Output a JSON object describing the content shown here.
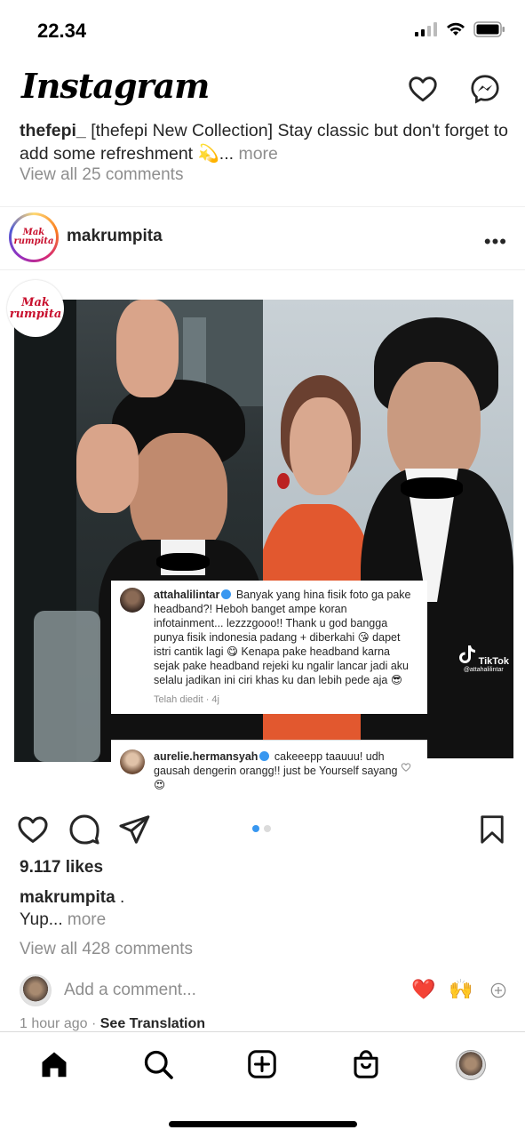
{
  "status_bar": {
    "time": "22.34"
  },
  "header": {
    "logo": "Instagram"
  },
  "previous_post": {
    "caption_user": "thefepi_",
    "caption_text": "[thefepi New Collection] Stay classic but don't forget to add some refreshment 💫...",
    "more_label": "more",
    "view_comments": "View all 25 comments"
  },
  "post": {
    "username": "makrumpita",
    "avatar_text_line1": "Mak",
    "avatar_text_line2": "rumpita",
    "image": {
      "watermark_line1": "Mak",
      "watermark_line2": "rumpita",
      "tiktok_label": "TikTok",
      "tiktok_handle": "@attahalilintar",
      "comment1": {
        "user": "attahalilintar",
        "text": "Banyak yang hina fisik foto ga pake headband?! Heboh banget ampe koran infotainment... lezzzgooo!! Thank u god bangga punya fisik indonesia padang + diberkahi 😘 dapet istri cantik lagi 😋 Kenapa pake headband karna sejak pake headband rejeki ku ngalir lancar jadi aku selalu jadikan ini ciri khas ku dan lebih pede aja 😎",
        "meta": "Telah diedit · 4j"
      },
      "comment2": {
        "user": "aurelie.hermansyah",
        "text": "cakeeepp taauuu! udh gausah dengerin orangg!! just be Yourself sayang 😍"
      }
    },
    "likes": "9.117 likes",
    "caption_user": "makrumpita",
    "caption_user_suffix": ".",
    "caption_text": "Yup...",
    "more_label": "more",
    "view_comments": "View all 428 comments",
    "add_comment_placeholder": "Add a comment...",
    "quick_emoji_1": "❤️",
    "quick_emoji_2": "🙌",
    "time_ago": "1 hour ago",
    "separator": "·",
    "see_translation": "See Translation"
  },
  "colors": {
    "accent_blue": "#3897f0",
    "text": "#262626",
    "muted": "#8e8e8e"
  }
}
